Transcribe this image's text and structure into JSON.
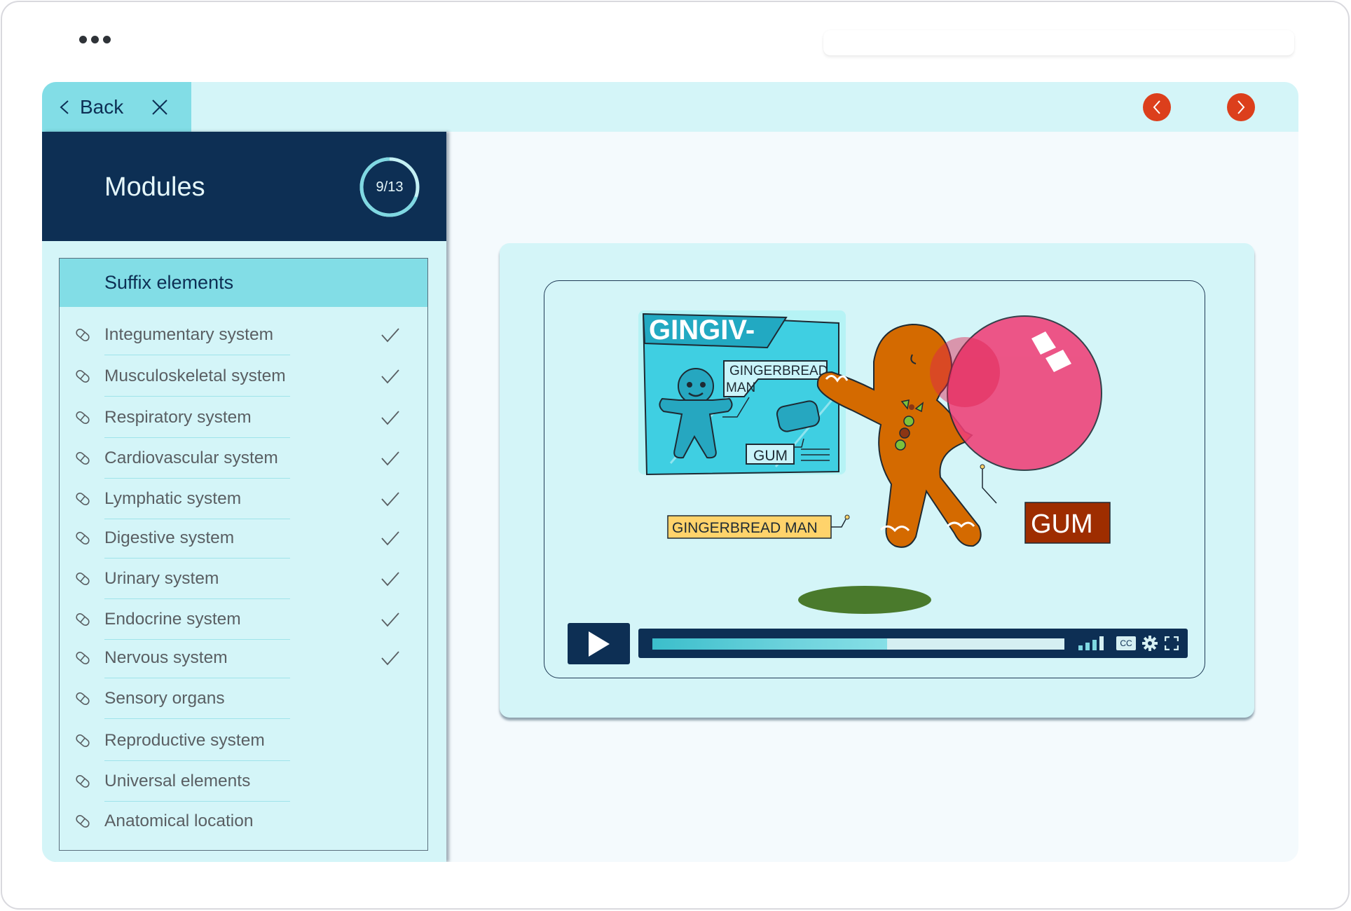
{
  "window": {
    "menu_icon": "more-horizontal-icon"
  },
  "topbar": {
    "back_label": "Back",
    "back_icon": "chevron-left-icon",
    "close_icon": "close-icon",
    "prev_icon": "chevron-left-icon",
    "next_icon": "chevron-right-icon",
    "nav_color": "#dc3f1c"
  },
  "sidebar": {
    "title": "Modules",
    "progress": {
      "label": "9/13",
      "completed": 9,
      "total": 13
    },
    "section_title": "Suffix elements",
    "items": [
      {
        "label": "Integumentary system",
        "completed": true
      },
      {
        "label": "Musculoskeletal system",
        "completed": true
      },
      {
        "label": "Respiratory system",
        "completed": true
      },
      {
        "label": "Cardiovascular system",
        "completed": true
      },
      {
        "label": "Lymphatic system",
        "completed": true
      },
      {
        "label": "Digestive system",
        "completed": true
      },
      {
        "label": "Urinary system",
        "completed": true
      },
      {
        "label": "Endocrine system",
        "completed": true
      },
      {
        "label": "Nervous system",
        "completed": true
      },
      {
        "label": "Sensory organs",
        "completed": false
      },
      {
        "label": "Reproductive system",
        "completed": false
      },
      {
        "label": "Universal elements",
        "completed": false
      },
      {
        "label": "Anatomical location",
        "completed": false
      }
    ],
    "item_icon": "pill-icon",
    "check_icon": "check-icon"
  },
  "video": {
    "illustration": {
      "board_title": "GINGIV-",
      "board_label_1_line1": "GINGERBREAD",
      "board_label_1_line2": "MAN",
      "board_label_2": "GUM",
      "label_gingerbread": "GINGERBREAD MAN",
      "label_gum": "GUM"
    },
    "progress": 0.57,
    "controls": {
      "play_icon": "play-icon",
      "volume_icon": "volume-bars-icon",
      "cc_label": "CC",
      "settings_icon": "gear-icon",
      "fullscreen_icon": "fullscreen-icon"
    }
  },
  "colors": {
    "navy": "#0d2f54",
    "cyan_light": "#d4f5f8",
    "cyan": "#82dde6",
    "accent_red": "#dc3f1c"
  }
}
